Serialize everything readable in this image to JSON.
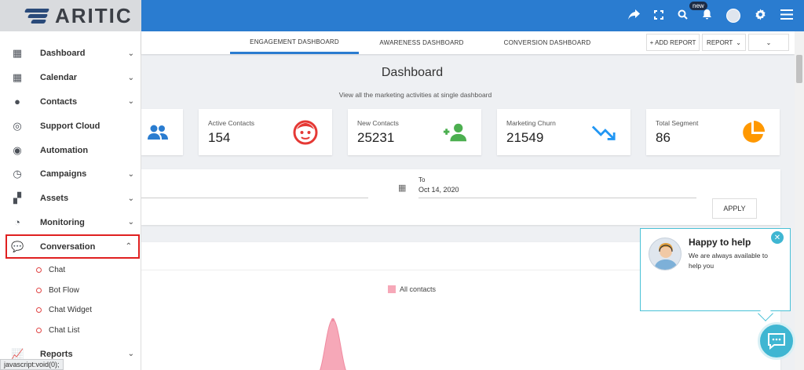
{
  "brand": {
    "name": "ARITIC"
  },
  "topbar": {
    "icons": [
      "share-icon",
      "fullscreen-icon",
      "search-icon",
      "bell-icon",
      "user-avatar",
      "gear-icon",
      "menu-icon"
    ],
    "new_badge": "new"
  },
  "sidebar": {
    "items": [
      {
        "label": "Dashboard",
        "icon": "dashboard-icon"
      },
      {
        "label": "Calendar",
        "icon": "calendar-icon"
      },
      {
        "label": "Contacts",
        "icon": "contacts-icon"
      },
      {
        "label": "Support Cloud",
        "icon": "support-icon"
      },
      {
        "label": "Automation",
        "icon": "automation-icon"
      },
      {
        "label": "Campaigns",
        "icon": "campaigns-icon"
      },
      {
        "label": "Assets",
        "icon": "assets-icon"
      },
      {
        "label": "Monitoring",
        "icon": "monitoring-icon"
      },
      {
        "label": "Conversation",
        "icon": "conversation-icon"
      },
      {
        "label": "Reports",
        "icon": "reports-icon"
      }
    ],
    "subitems": [
      "Chat",
      "Bot Flow",
      "Chat Widget",
      "Chat List"
    ]
  },
  "status_bar": "javascript:void(0);",
  "tabs": {
    "engagement": "ENGAGEMENT DASHBOARD",
    "awareness": "AWARENESS DASHBOARD",
    "conversion": "CONVERSION DASHBOARD",
    "add_report": "+ ADD REPORT",
    "report": "REPORT"
  },
  "main": {
    "title": "Dashboard",
    "subtitle": "View all the marketing activities at single dashboard",
    "cards": [
      {
        "label": "Active Contacts",
        "value": "154",
        "color": "#e53935"
      },
      {
        "label": "New Contacts",
        "value": "25231",
        "color": "#4caf50"
      },
      {
        "label": "Marketing Churn",
        "value": "21549",
        "color": "#2196f3"
      },
      {
        "label": "Total Segment",
        "value": "86",
        "color": "#ff9800"
      }
    ],
    "filter": {
      "to_label": "To",
      "to_date": "Oct 14, 2020",
      "apply": "APPLY"
    },
    "legend": "All contacts",
    "accent": "#2a7cd0"
  },
  "chat": {
    "title": "Happy to help",
    "text": "We are always available to help you",
    "color": "#3fb6d2"
  }
}
